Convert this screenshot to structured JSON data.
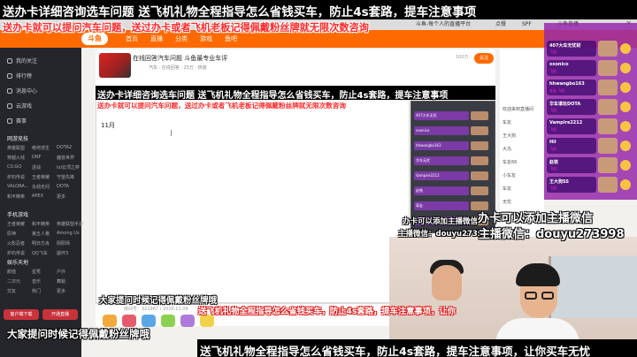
{
  "browser": {
    "tabs": [
      "斗鱼-每个人的直播平台",
      "点餐",
      "SPF",
      "斗鱼直播"
    ]
  },
  "nav": {
    "logo": "斗鱼",
    "links": [
      "首页",
      "直播",
      "分类",
      "游戏",
      "鱼吧"
    ]
  },
  "sidebar": {
    "items": [
      "我的关注",
      "排行榜",
      "消息中心",
      "云游戏",
      "赛事"
    ],
    "section_hot": "网游竞技",
    "hot_grid": [
      "英雄联盟",
      "绝地求生",
      "DOTA2",
      "穿越火线",
      "DNF",
      "魔兽世界",
      "CS:GO",
      "逆战",
      "lol云顶之弈",
      "炉石传说",
      "王者荣耀",
      "守望先锋",
      "VALORA...",
      "永劫无间",
      "DOTA",
      "和平精英",
      "APEX",
      "更多"
    ],
    "section_mobile": "手机游戏",
    "mobile_grid": [
      "王者荣耀",
      "和平精英",
      "英雄联盟手游",
      "原神",
      "第五人格",
      "Among Us",
      "火影忍者",
      "明日方舟",
      "阴阳师",
      "炉石传说",
      "QQ飞车",
      "崩坏3"
    ],
    "section_fun": "娱乐天地",
    "fun_grid": [
      "颜值",
      "星秀",
      "户外",
      "二次元",
      "音乐",
      "舞蹈",
      "交友",
      "热门",
      "更多"
    ],
    "btn_left": "客户端下载",
    "btn_right": "开通直播"
  },
  "room": {
    "title": "在线回答汽车问题 斗鱼最专业车评",
    "meta": "汽车 · 在线回答 · 25万 · 热度",
    "hot": "100万",
    "follow": "关注",
    "room_id": "房间号：321987 / 2020.11.09"
  },
  "doc": {
    "text": "11月"
  },
  "preview_rows": [
    "407大车无忧",
    "xxonico",
    "hhwangbo163",
    "华车无忧",
    "Vampire2212",
    "赵铁",
    "車友",
    "王大狗SS"
  ],
  "chat_lines": [
    "欢迎来到直播间",
    "车友",
    "王大狗",
    "大鸟",
    "车友66",
    "小车友",
    "车友",
    "无忧"
  ],
  "rank": [
    {
      "name": "407大车无忧财",
      "sub": "飞机"
    },
    {
      "name": "xxonico",
      "sub": "飞机"
    },
    {
      "name": "hhwangbo163",
      "sub": "车友 飞机"
    },
    {
      "name": "华车谁玩DOTA",
      "sub": "飞机"
    },
    {
      "name": "Vampire2212",
      "sub": "飞机"
    },
    {
      "name": "Hil",
      "sub": "飞机"
    },
    {
      "name": "赵铁",
      "sub": "飞机"
    },
    {
      "name": "王大狗SS",
      "sub": "飞机"
    }
  ],
  "overlays": {
    "top_banner": "送办卡详细咨询选车问题  送飞机礼物全程指导怎么省钱买车，防止4s套路，提车注意事项",
    "top_red": "送办卡就可以提问汽车问题，送过办卡或者飞机老板记得佩戴粉丝牌就无限次数咨询",
    "mid_banner": "送办卡详细咨询选车问题  送飞机礼物全程指导怎么省钱买车，防止4s套路，提车注意事项",
    "mid_red": "送办卡就可以提问汽车问题，送过办卡或者飞机老板记得佩戴粉丝牌就无限次数咨询",
    "wechat_small_1": "办卡可以添加主播微信",
    "wechat_small_2": "主播微信：douyu273998",
    "wechat_big_1": "办卡可以添加主播微信",
    "wechat_big_2": "主播微信：douyu273998",
    "fan_small": "大家提问时候记得佩戴粉丝牌哦",
    "gift_red": "送飞机礼物全程指导怎么省钱买车，防止4s套路，提车注意事项，让你",
    "fan_big": "大家提问时候记得佩戴粉丝牌哦",
    "bottom_banner": "送飞机礼物全程指导怎么省钱买车，防止4s套路，提车注意事项，让你买车无忧"
  }
}
